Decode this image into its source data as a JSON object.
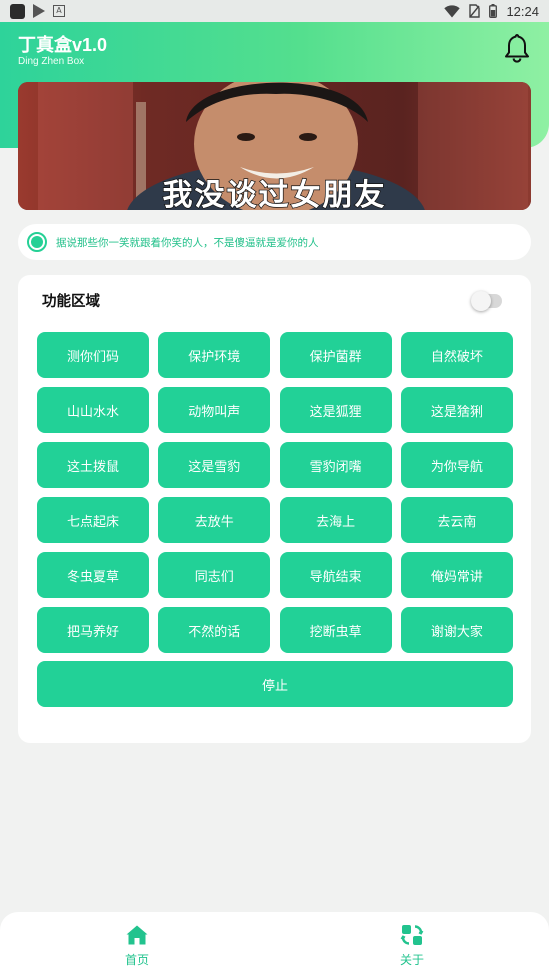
{
  "status_bar": {
    "time": "12:24",
    "icons": [
      "app-square-icon",
      "play-store-icon",
      "a-icon",
      "wifi-icon",
      "no-sim-icon",
      "battery-icon"
    ]
  },
  "header": {
    "title": "丁真盒v1.0",
    "subtitle": "Ding Zhen Box",
    "bell_icon": "bell-icon"
  },
  "banner": {
    "caption": "我没谈过女朋友"
  },
  "notice": {
    "text": "据说那些你一笑就跟着你笑的人，不是傻逼就是爱你的人"
  },
  "function_area": {
    "title": "功能区域",
    "toggle_on": false,
    "buttons": [
      "测你们码",
      "保护环境",
      "保护菌群",
      "自然破坏",
      "山山水水",
      "动物叫声",
      "这是狐狸",
      "这是猞猁",
      "这土拨鼠",
      "这是雪豹",
      "雪豹闭嘴",
      "为你导航",
      "七点起床",
      "去放牛",
      "去海上",
      "去云南",
      "冬虫夏草",
      "同志们",
      "导航结束",
      "俺妈常讲",
      "把马养好",
      "不然的话",
      "挖断虫草",
      "谢谢大家"
    ],
    "stop_label": "停止"
  },
  "bottom_nav": {
    "items": [
      {
        "label": "首页",
        "icon": "home-icon"
      },
      {
        "label": "关于",
        "icon": "apps-icon"
      }
    ]
  },
  "colors": {
    "accent": "#22d197",
    "header_gradient": [
      "#2ed39a",
      "#8ff0a3"
    ],
    "background": "#f1f2f1"
  }
}
